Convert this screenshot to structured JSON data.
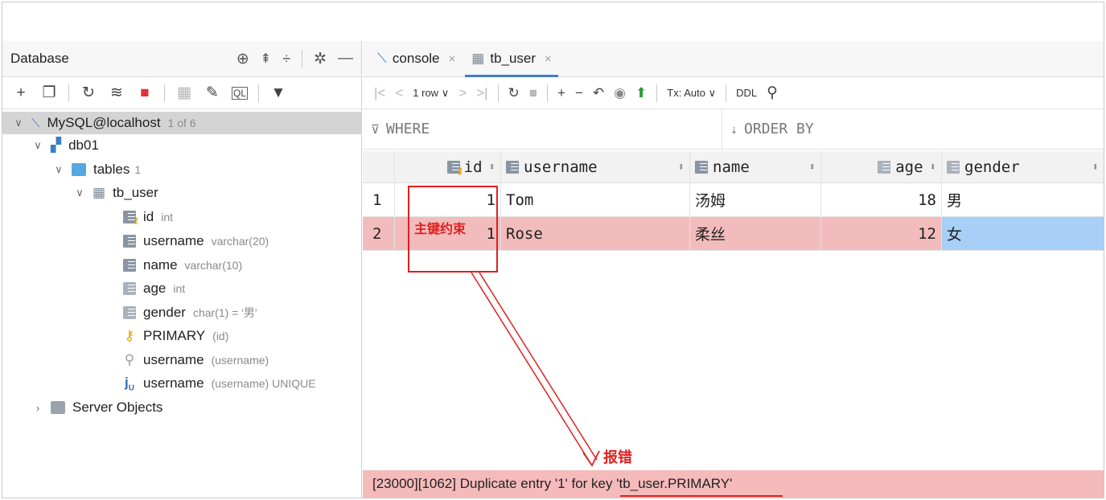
{
  "left_panel": {
    "title": "Database",
    "header_icons": [
      "crosshair-icon",
      "expand-all-icon",
      "collapse-all-icon",
      "gear-icon",
      "minimize-icon"
    ],
    "toolbar_icons": [
      "add-icon",
      "copy-icon",
      "refresh-icon",
      "schema-icon",
      "stop-icon",
      "table-icon",
      "edit-icon",
      "query-console-icon",
      "filter-icon"
    ],
    "tree": {
      "connection": {
        "label": "MySQL@localhost",
        "meta": "1 of 6"
      },
      "schema": {
        "label": "db01"
      },
      "tables_folder": {
        "label": "tables",
        "meta": "1"
      },
      "table": {
        "label": "tb_user"
      },
      "columns": [
        {
          "label": "id",
          "meta": "int"
        },
        {
          "label": "username",
          "meta": "varchar(20)"
        },
        {
          "label": "name",
          "meta": "varchar(10)"
        },
        {
          "label": "age",
          "meta": "int"
        },
        {
          "label": "gender",
          "meta": "char(1) = '男'"
        }
      ],
      "keys": [
        {
          "label": "PRIMARY",
          "meta": "(id)"
        },
        {
          "label": "username",
          "meta": "(username)"
        },
        {
          "label": "username",
          "meta": "(username) UNIQUE"
        }
      ],
      "server_objects": {
        "label": "Server Objects"
      }
    }
  },
  "tabs": [
    {
      "label": "console",
      "close": "×"
    },
    {
      "label": "tb_user",
      "close": "×"
    }
  ],
  "result_toolbar": {
    "rows_selector": "1 row",
    "tx_mode": "Tx: Auto",
    "ddl_label": "DDL"
  },
  "filter": {
    "where_label": "WHERE",
    "order_label": "ORDER BY"
  },
  "grid": {
    "columns": [
      "id",
      "username",
      "name",
      "age",
      "gender"
    ],
    "rows": [
      {
        "rownum": "1",
        "id": "1",
        "username": "Tom",
        "name": "汤姆",
        "age": "18",
        "gender": "男"
      },
      {
        "rownum": "2",
        "id": "1",
        "username": "Rose",
        "name": "柔丝",
        "age": "12",
        "gender": "女"
      }
    ]
  },
  "status_message": "[23000][1062] Duplicate entry '1' for key 'tb_user.PRIMARY'",
  "annotations": {
    "primary_key_note": "主键约束",
    "error_note": "报错",
    "color": "#e02020"
  }
}
